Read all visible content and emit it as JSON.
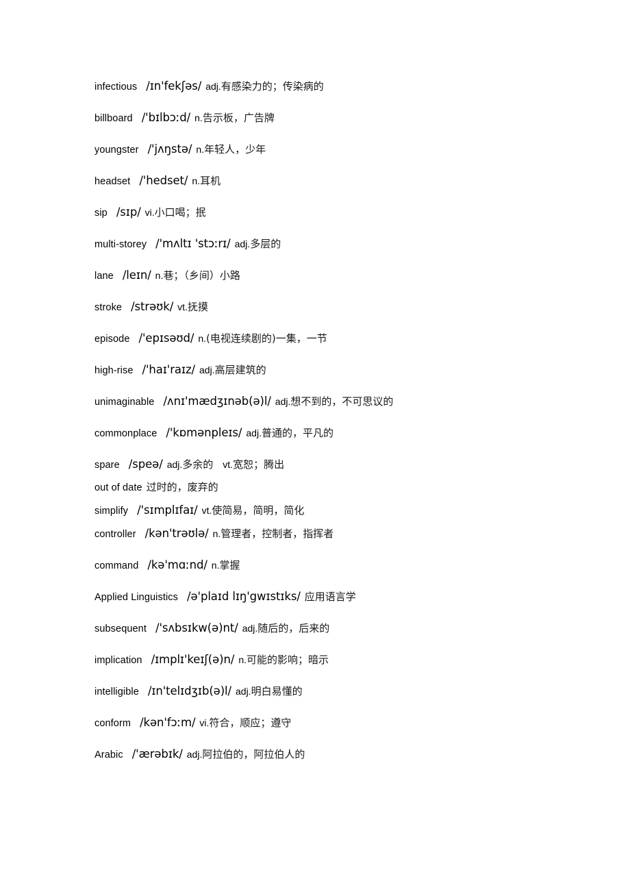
{
  "document": {
    "type": "vocabulary-list",
    "entries": [
      {
        "word": "infectious",
        "phonetic": "/ɪn'fekʃəs/",
        "pos": "adj.",
        "meaning": "有感染力的；传染病的",
        "tight": false
      },
      {
        "word": "billboard",
        "phonetic": "/'bɪlbɔːd/",
        "pos": "n.",
        "meaning": "告示板，广告牌",
        "tight": false
      },
      {
        "word": "youngster",
        "phonetic": "/'jʌŋstə/",
        "pos": "n.",
        "meaning": "年轻人，少年",
        "tight": false
      },
      {
        "word": "headset",
        "phonetic": "/'hedset/",
        "pos": "n.",
        "meaning": "耳机",
        "tight": false
      },
      {
        "word": "sip",
        "phonetic": "/sɪp/",
        "pos": "vi.",
        "meaning": "小口喝；抿",
        "tight": false
      },
      {
        "word": "multi-storey",
        "phonetic": "/'mʌltɪ 'stɔːrɪ/",
        "pos": "adj.",
        "meaning": "多层的",
        "tight": false
      },
      {
        "word": "lane",
        "phonetic": "/leɪn/",
        "pos": "n.",
        "meaning": "巷；（乡间）小路",
        "tight": false
      },
      {
        "word": "stroke",
        "phonetic": "/strəʊk/",
        "pos": "vt.",
        "meaning": "抚摸",
        "tight": false
      },
      {
        "word": "episode",
        "phonetic": "/'epɪsəʊd/",
        "pos": "n.",
        "meaning": "(电视连续剧的)一集，一节",
        "tight": false
      },
      {
        "word": "high-rise",
        "phonetic": "/'haɪ'raɪz/",
        "pos": "adj.",
        "meaning": "高层建筑的",
        "tight": false
      },
      {
        "word": "unimaginable",
        "phonetic": "/ʌnɪ'mædʒɪnəb(ə)l/",
        "pos": "adj.",
        "meaning": "想不到的，不可思议的",
        "tight": false
      },
      {
        "word": "commonplace",
        "phonetic": "/'kɒmənpleɪs/",
        "pos": "adj.",
        "meaning": "普通的，平凡的",
        "tight": false
      },
      {
        "word": "spare",
        "phonetic": "/speə/",
        "pos": "adj.",
        "meaning": "多余的",
        "pos2": "vt.",
        "meaning2": "宽恕；腾出",
        "tight": true
      },
      {
        "word": "out of date",
        "phonetic": "",
        "pos": "",
        "meaning": "过时的，废弃的",
        "tight": true
      },
      {
        "word": "simplify",
        "phonetic": "/'sɪmplɪfaɪ/",
        "pos": "vt.",
        "meaning": "使简易，简明，简化",
        "tight": true
      },
      {
        "word": "controller",
        "phonetic": "/kən'trəʊlə/",
        "pos": "n.",
        "meaning": "管理者，控制者，指挥者",
        "tight": false
      },
      {
        "word": "command",
        "phonetic": "/kə'mɑːnd/",
        "pos": "n.",
        "meaning": "掌握",
        "tight": false
      },
      {
        "word": "Applied Linguistics",
        "phonetic": "/ə'plaɪd lɪŋ'gwɪstɪks/",
        "pos": "",
        "meaning": "应用语言学",
        "tight": false
      },
      {
        "word": "subsequent",
        "phonetic": "/'sʌbsɪkw(ə)nt/",
        "pos": "adj.",
        "meaning": "随后的，后来的",
        "tight": false
      },
      {
        "word": "implication",
        "phonetic": "/ɪmplɪ'keɪʃ(ə)n/",
        "pos": "n.",
        "meaning": "可能的影响；暗示",
        "tight": false
      },
      {
        "word": "intelligible",
        "phonetic": "/ɪn'telɪdʒɪb(ə)l/",
        "pos": "adj.",
        "meaning": "明白易懂的",
        "tight": false
      },
      {
        "word": "conform",
        "phonetic": "/kən'fɔːm/",
        "pos": "vi.",
        "meaning": "符合，顺应；遵守",
        "tight": false
      },
      {
        "word": "Arabic",
        "phonetic": "/'ærəbɪk/",
        "pos": "adj.",
        "meaning": "阿拉伯的，阿拉伯人的",
        "tight": false
      }
    ]
  }
}
